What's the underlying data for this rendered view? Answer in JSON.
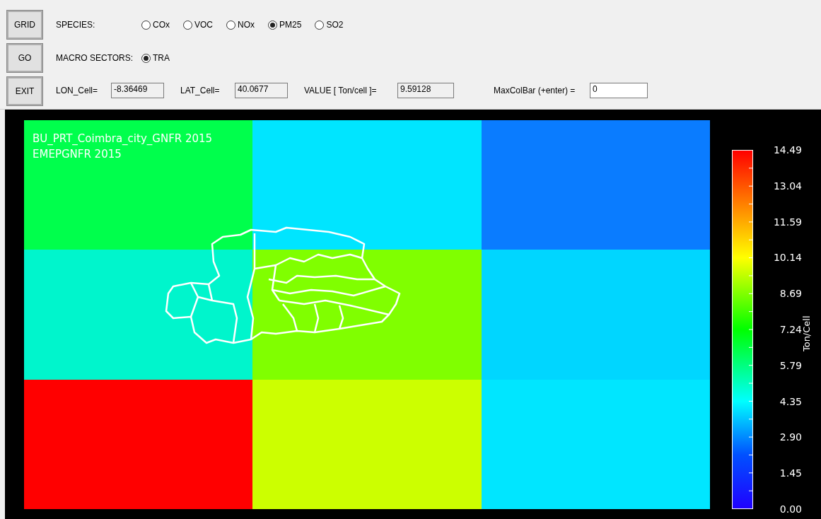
{
  "buttons": [
    "GRID",
    "GO",
    "EXIT"
  ],
  "species": {
    "label": "SPECIES:",
    "options": [
      {
        "label": "COx",
        "selected": false
      },
      {
        "label": "VOC",
        "selected": false
      },
      {
        "label": "NOx",
        "selected": false
      },
      {
        "label": "PM25",
        "selected": true
      },
      {
        "label": "SO2",
        "selected": false
      }
    ]
  },
  "macro_sectors": {
    "label": "MACRO SECTORS:",
    "options": [
      {
        "label": "TRA",
        "selected": true
      }
    ]
  },
  "fields": [
    {
      "label": "LON_Cell=",
      "value": "-8.36469",
      "editable": false
    },
    {
      "label": "LAT_Cell=",
      "value": "40.0677",
      "editable": false
    },
    {
      "label": "VALUE [ Ton/cell ]=",
      "value": "9.59128",
      "editable": false
    },
    {
      "label": "MaxColBar (+enter) =",
      "value": "0",
      "editable": true
    }
  ],
  "map": {
    "titles": [
      "BU_PRT_Coimbra_city_GNFR 2015",
      "EMEPGNFR 2015"
    ],
    "cells": [
      [
        {
          "color": "#00ff4c"
        },
        {
          "color": "#00e5ff"
        },
        {
          "color": "#0a7cff"
        }
      ],
      [
        {
          "color": "#00f5cc"
        },
        {
          "color": "#80ff00"
        },
        {
          "color": "#00d6ff"
        }
      ],
      [
        {
          "color": "#ff0000"
        },
        {
          "color": "#ccff00"
        },
        {
          "color": "#00e6ff"
        }
      ]
    ]
  },
  "colorbar": {
    "title": "Ton/Cell",
    "ticks": [
      "14.49",
      "13.04",
      "11.59",
      "10.14",
      "8.69",
      "7.24",
      "5.79",
      "4.35",
      "2.90",
      "1.45",
      "0.00"
    ]
  }
}
